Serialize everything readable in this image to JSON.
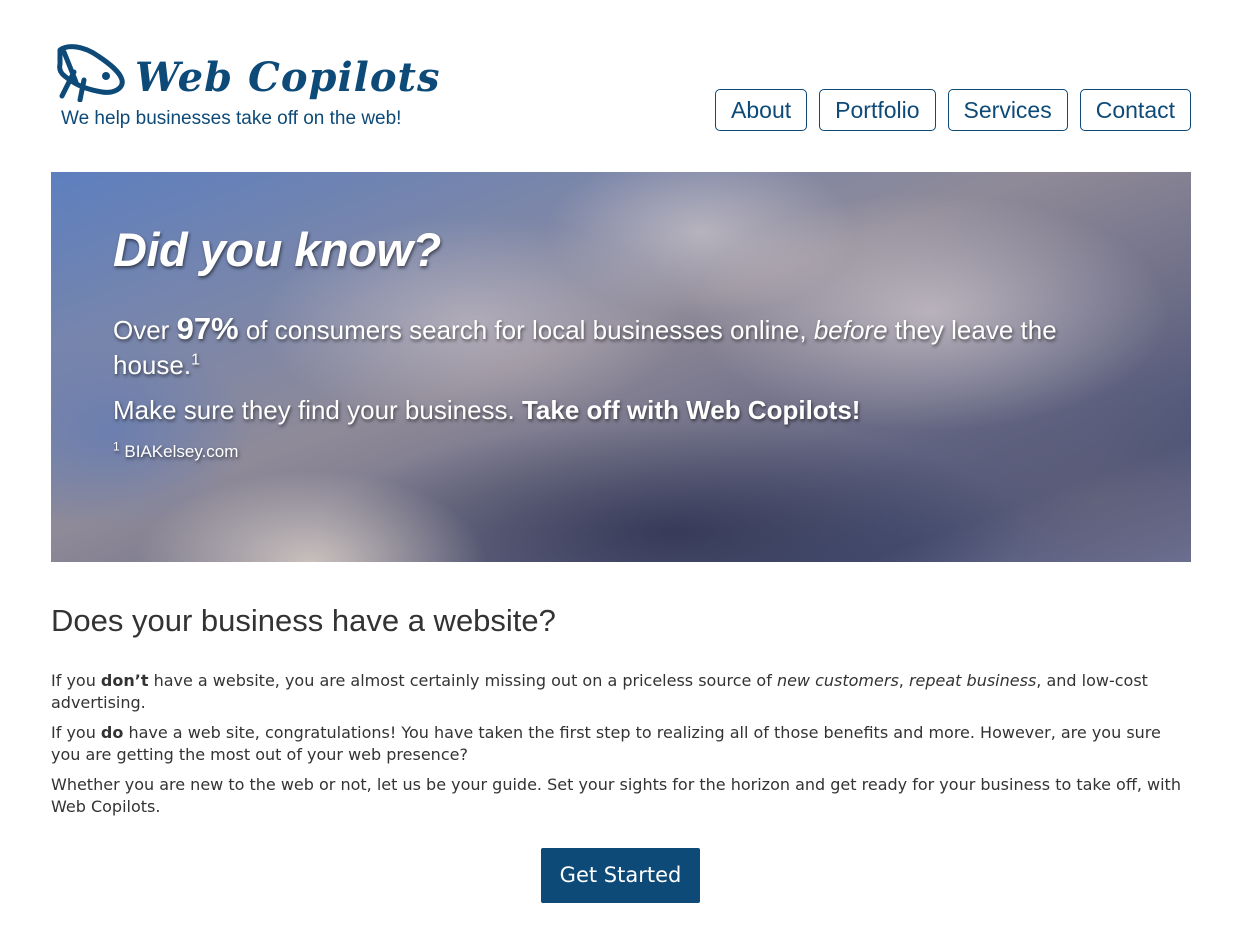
{
  "brand": {
    "name": "Web Copilots",
    "tagline": "We help businesses take off on the web!",
    "logo_icon": "rocket-plane-icon",
    "color": "#0d4a78"
  },
  "nav": {
    "items": [
      {
        "label": "About"
      },
      {
        "label": "Portfolio"
      },
      {
        "label": "Services"
      },
      {
        "label": "Contact"
      }
    ]
  },
  "hero": {
    "title": "Did you know?",
    "line1_prefix": "Over ",
    "line1_stat": "97%",
    "line1_mid": " of consumers search for local businesses online, ",
    "line1_em": "before",
    "line1_suffix": " they leave the house.",
    "line1_sup": "1",
    "line2_prefix": "Make sure they find your business. ",
    "line2_strong": "Take off with Web Copilots!",
    "note_sup": "1",
    "note_text": " BIAKelsey.com"
  },
  "section": {
    "title": "Does your business have a website?",
    "p1_a": "If you ",
    "p1_b": "don’t",
    "p1_c": " have a website, you are almost certainly missing out on a priceless source of ",
    "p1_d": "new customers",
    "p1_e": ", ",
    "p1_f": "repeat business",
    "p1_g": ", and low-cost advertising.",
    "p2_a": "If you ",
    "p2_b": "do",
    "p2_c": " have a web site, congratulations! You have taken the first step to realizing all of those benefits and more. However, are you sure you are getting the most out of your web presence?",
    "p3": "Whether you are new to the web or not, let us be your guide. Set your sights for the horizon and get ready for your business to take off, with Web Copilots."
  },
  "cta": {
    "label": "Get Started",
    "color": "#0d4a78"
  }
}
